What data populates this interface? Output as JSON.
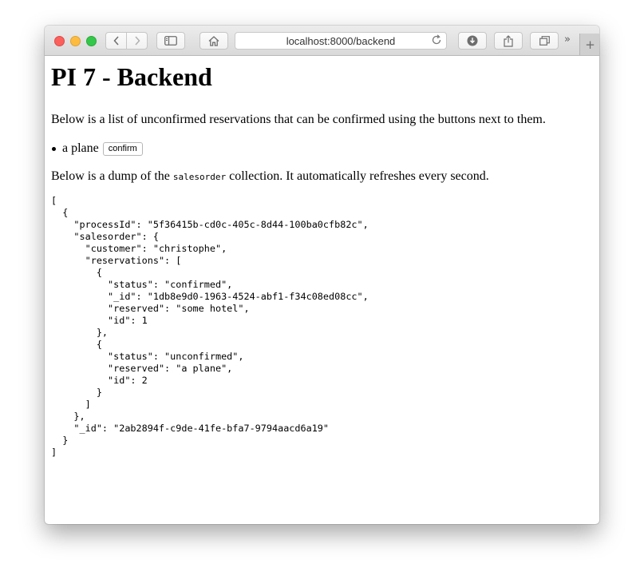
{
  "browser": {
    "url": "localhost:8000/backend"
  },
  "page": {
    "title": "PI 7 - Backend",
    "intro": "Below is a list of unconfirmed reservations that can be confirmed using the buttons next to them.",
    "reservations": [
      {
        "label": "a plane",
        "button_label": "confirm"
      }
    ],
    "dump_prefix": "Below is a dump of the ",
    "dump_code": "salesorder",
    "dump_suffix": " collection. It automatically refreshes every second.",
    "dump": "[\n  {\n    \"processId\": \"5f36415b-cd0c-405c-8d44-100ba0cfb82c\",\n    \"salesorder\": {\n      \"customer\": \"christophe\",\n      \"reservations\": [\n        {\n          \"status\": \"confirmed\",\n          \"_id\": \"1db8e9d0-1963-4524-abf1-f34c08ed08cc\",\n          \"reserved\": \"some hotel\",\n          \"id\": 1\n        },\n        {\n          \"status\": \"unconfirmed\",\n          \"reserved\": \"a plane\",\n          \"id\": 2\n        }\n      ]\n    },\n    \"_id\": \"2ab2894f-c9de-41fe-bfa7-9794aacd6a19\"\n  }\n]"
  }
}
